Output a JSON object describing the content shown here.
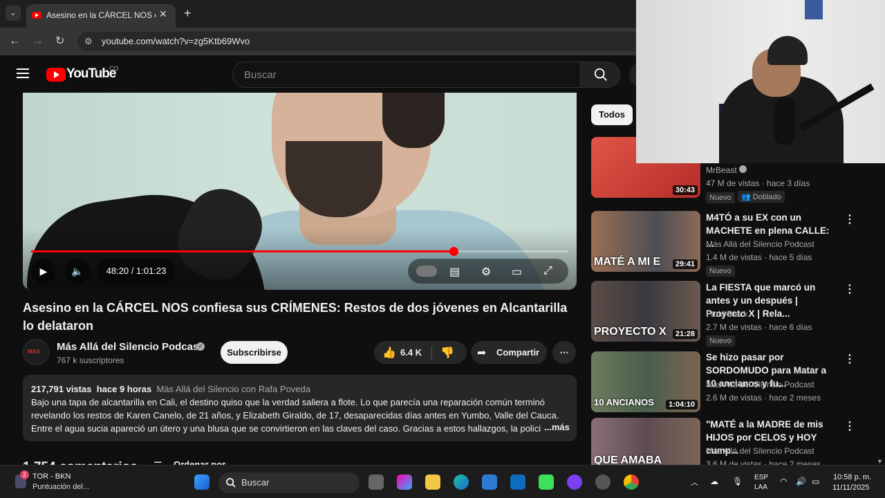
{
  "browser": {
    "tab_title": "Asesino en la CÁRCEL NOS con",
    "url": "youtube.com/watch?v=zg5Ktb69Wvo"
  },
  "youtube": {
    "logo_text": "YouTube",
    "country": "CO",
    "search_placeholder": "Buscar"
  },
  "player": {
    "time": "48:20 / 1:01:23",
    "progress_fraction": 0.787
  },
  "video": {
    "title": "Asesino en la CÁRCEL NOS confiesa sus CRÍMENES: Restos de dos jóvenes en Alcantarilla lo delataron",
    "channel": "Más Allá del Silencio Podcast",
    "subscribers": "767 k suscriptores",
    "subscribe_label": "Subscribirse",
    "likes": "6.4 K",
    "share_label": "Compartir",
    "views": "217,791 vistas",
    "age": "hace 9 horas",
    "uploader_line": "Más Allá del Silencio con Rafa Poveda",
    "description": "Bajo una tapa de alcantarilla en Cali, el destino quiso que la verdad saliera a flote. Lo que parecía una reparación común terminó revelando los restos de Karen Canelo, de 21 años, y Elizabeth Giraldo, de 17, desaparecidas días antes en Yumbo, Valle del Cauca. Entre el agua sucia apareció un útero y una blusa que se convirtieron en las claves del caso. Gracias a estos hallazgos, la polici",
    "more_label": "...más",
    "comments": "1.754 comentarios",
    "sort_label": "Ordenar por"
  },
  "sidebar": {
    "chip": "Todos",
    "items": [
      {
        "title": "",
        "channel": "MrBeast",
        "views": "47 M de vistas · hace 3 días",
        "duration": "30:43",
        "badges": [
          "Nuevo",
          "Doblado"
        ],
        "thumb_color": "#c9403a"
      },
      {
        "title": "M4TÓ a su EX con un MACHETE en plena CALLE: ...",
        "channel": "Más Allá del Silencio Podcast",
        "views": "1.4 M de vistas · hace 5 días",
        "duration": "29:41",
        "badges": [
          "Nuevo"
        ],
        "thumb_text": "MATÉ A MI E",
        "thumb_color": "#5a4a3e"
      },
      {
        "title": "La FIESTA que marcó un antes y un después | Proyecto X | Rela...",
        "channel": "Farid Dieck",
        "views": "2.7 M de vistas · hace 6 días",
        "duration": "21:28",
        "badges": [
          "Nuevo"
        ],
        "thumb_text": "PROYECTO X",
        "thumb_color": "#3b3b42"
      },
      {
        "title": "Se hizo pasar por SORDOMUDO para Matar a 10 ancianos y fu...",
        "channel": "Más Allá del Silencio Podcast",
        "views": "2.6 M de vistas · hace 2 meses",
        "duration": "1:04:10",
        "badges": [],
        "thumb_text": "10 ANCIANOS",
        "thumb_color": "#4f6b57"
      },
      {
        "title": "\"MATÉ a la MADRE de mis HIJOS por CELOS y HOY cump...",
        "channel": "Más Allá del Silencio Podcast",
        "views": "3.6 M de vistas · hace 2 meses",
        "duration": "",
        "badges": [],
        "thumb_text": "QUE AMABA",
        "thumb_color": "#6a5560"
      }
    ]
  },
  "taskbar": {
    "weather_badge": "2",
    "app_line1": "TOR - BKN",
    "app_line2": "Puntuación del...",
    "search_label": "Buscar",
    "lang1": "ESP",
    "lang2": "LAA",
    "time": "10:58 p. m.",
    "date": "11/11/2025"
  }
}
